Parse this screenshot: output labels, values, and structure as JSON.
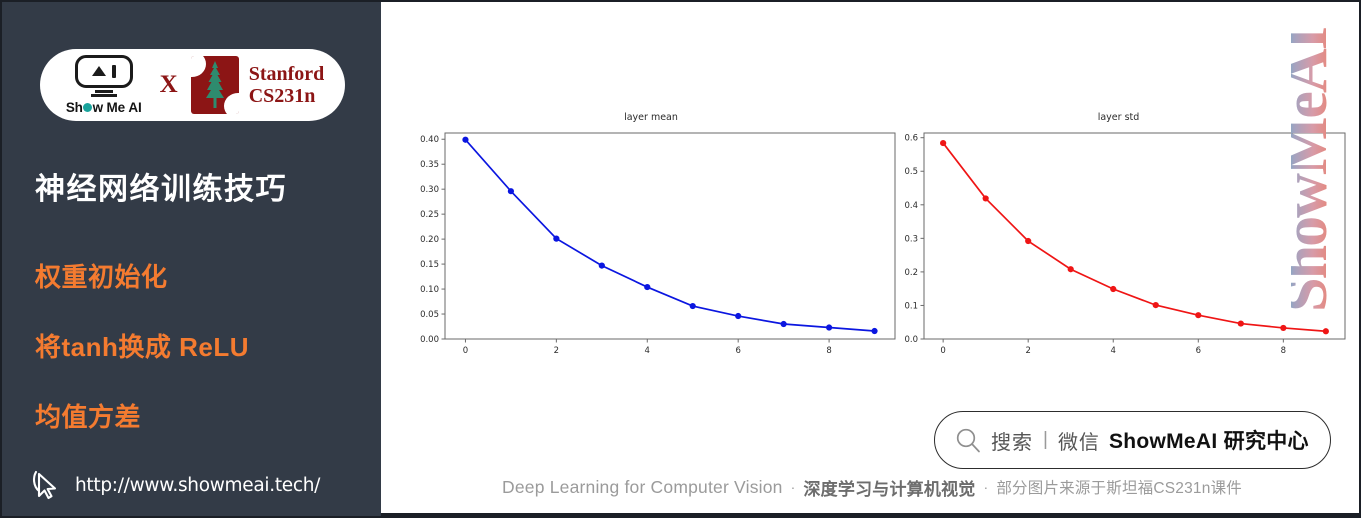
{
  "sidebar": {
    "badge": {
      "logo_name": "ShowMeAI",
      "logo_word": "Show Me AI",
      "x_symbol": "X",
      "stanford_line1": "Stanford",
      "stanford_line2": "CS231n"
    },
    "title": "神经网络训练技巧",
    "bullets": [
      "权重初始化",
      "将tanh换成 ReLU",
      "均值方差"
    ],
    "url": "http://www.showmeai.tech/",
    "bg_color": "#333b47",
    "accent_color": "#f47b30"
  },
  "watermark": {
    "text": "ShowMeAI",
    "color_top": "#1cb8d4",
    "color_bottom": "#ef7a5e"
  },
  "search": {
    "label": "搜索",
    "divider": "|",
    "channel": "微信",
    "brand": "ShowMeAI 研究中心"
  },
  "footer": {
    "english": "Deep Learning for Computer Vision",
    "dot1": "·",
    "chinese_strong": "深度学习与计算机视觉",
    "dot2": "·",
    "chinese_note": "部分图片来源于斯坦福CS231n课件"
  },
  "chart_data": [
    {
      "type": "line",
      "title": "layer mean",
      "xlabel": "",
      "ylabel": "",
      "x": [
        0,
        1,
        2,
        3,
        4,
        5,
        6,
        7,
        8,
        9
      ],
      "values": [
        0.399,
        0.296,
        0.201,
        0.147,
        0.104,
        0.066,
        0.046,
        0.03,
        0.023,
        0.016
      ],
      "xlim": [
        -0.45,
        9.45
      ],
      "ylim": [
        0.0,
        0.4125
      ],
      "xticks": [
        0,
        2,
        4,
        6,
        8
      ],
      "xticklabels": [
        "0",
        "2",
        "4",
        "6",
        "8"
      ],
      "yticks": [
        0.0,
        0.05,
        0.1,
        0.15,
        0.2,
        0.25,
        0.3,
        0.35,
        0.4
      ],
      "yticklabels": [
        "0.00",
        "0.05",
        "0.10",
        "0.15",
        "0.20",
        "0.25",
        "0.30",
        "0.35",
        "0.40"
      ],
      "color": "#0b16e0",
      "marker": "o",
      "grid": false,
      "legend": null
    },
    {
      "type": "line",
      "title": "layer std",
      "xlabel": "",
      "ylabel": "",
      "x": [
        0,
        1,
        2,
        3,
        4,
        5,
        6,
        7,
        8,
        9
      ],
      "values": [
        0.584,
        0.419,
        0.292,
        0.208,
        0.149,
        0.101,
        0.071,
        0.046,
        0.033,
        0.023
      ],
      "xlim": [
        -0.45,
        9.45
      ],
      "ylim": [
        0.0,
        0.614
      ],
      "xticks": [
        0,
        2,
        4,
        6,
        8
      ],
      "xticklabels": [
        "0",
        "2",
        "4",
        "6",
        "8"
      ],
      "yticks": [
        0.0,
        0.1,
        0.2,
        0.3,
        0.4,
        0.5,
        0.6
      ],
      "yticklabels": [
        "0.0",
        "0.1",
        "0.2",
        "0.3",
        "0.4",
        "0.5",
        "0.6"
      ],
      "color": "#ef1515",
      "marker": "o",
      "grid": false,
      "legend": null
    }
  ]
}
